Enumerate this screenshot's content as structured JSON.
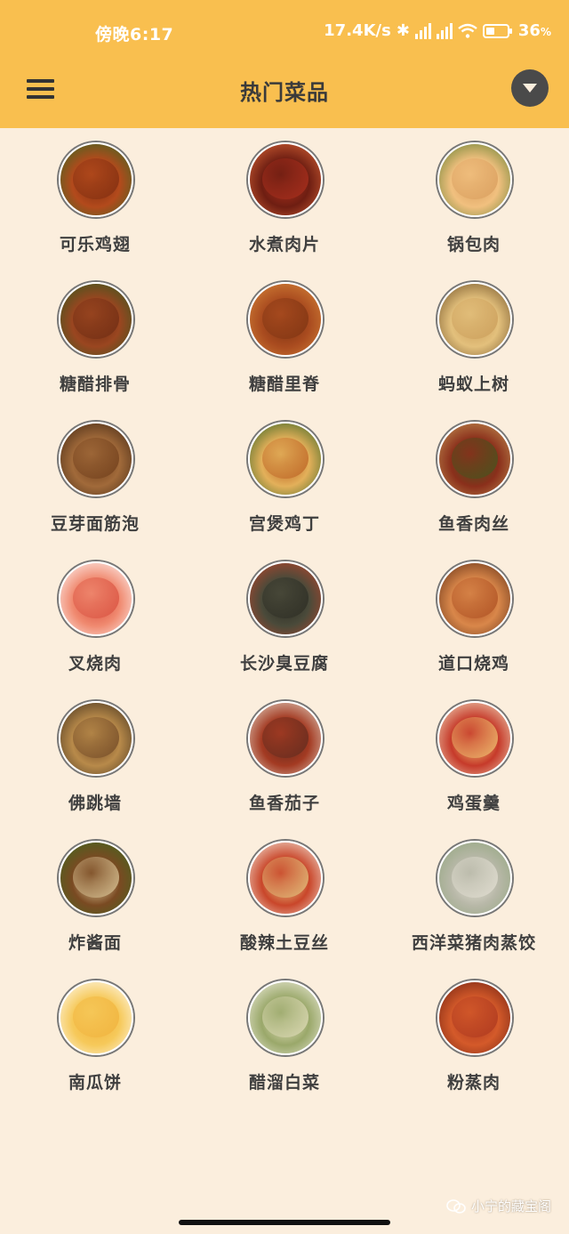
{
  "status_bar": {
    "time": "傍晚6:17",
    "net_speed": "17.4K/s",
    "battery": "36",
    "battery_unit": "%"
  },
  "toolbar": {
    "title": "热门菜品",
    "menu_icon": "hamburger-menu-icon",
    "dropdown_icon": "caret-down-icon"
  },
  "dishes": [
    {
      "name": "可乐鸡翅",
      "colors": [
        "#7a2b0f",
        "#b34a1c",
        "#2f6b22"
      ]
    },
    {
      "name": "水煮肉片",
      "colors": [
        "#b3321f",
        "#6e1e12",
        "#e06a3a"
      ]
    },
    {
      "name": "锅包肉",
      "colors": [
        "#d69a5a",
        "#f1c07f",
        "#5a7b2a"
      ]
    },
    {
      "name": "糖醋排骨",
      "colors": [
        "#6b2a12",
        "#9a4620",
        "#2c5a1e"
      ]
    },
    {
      "name": "糖醋里脊",
      "colors": [
        "#7a3211",
        "#a94b1f",
        "#d98a3b"
      ]
    },
    {
      "name": "蚂蚁上树",
      "colors": [
        "#c89a57",
        "#e3c07c",
        "#6a4b22"
      ]
    },
    {
      "name": "豆芽面筋泡",
      "colors": [
        "#6b3a18",
        "#a16a3a",
        "#3a2210"
      ]
    },
    {
      "name": "宫煲鸡丁",
      "colors": [
        "#b85a1e",
        "#e3b05a",
        "#2a5e1e"
      ]
    },
    {
      "name": "鱼香肉丝",
      "colors": [
        "#3c5a1e",
        "#8a2f1b",
        "#c79a57"
      ]
    },
    {
      "name": "叉烧肉",
      "colors": [
        "#d64a3a",
        "#f08a70",
        "#ffffff"
      ]
    },
    {
      "name": "长沙臭豆腐",
      "colors": [
        "#2a2a22",
        "#4a4a3a",
        "#c0452a"
      ]
    },
    {
      "name": "道口烧鸡",
      "colors": [
        "#a94a1e",
        "#d9874a",
        "#5a2a12"
      ]
    },
    {
      "name": "佛跳墙",
      "colors": [
        "#6a4222",
        "#b88a4a",
        "#3a2a1a"
      ]
    },
    {
      "name": "鱼香茄子",
      "colors": [
        "#5a2a1e",
        "#a33a22",
        "#e8e0d0"
      ]
    },
    {
      "name": "鸡蛋羹",
      "colors": [
        "#f5d47a",
        "#c63a2a",
        "#f4e8c8"
      ]
    },
    {
      "name": "炸酱面",
      "colors": [
        "#e8d7a8",
        "#7a4a22",
        "#3a6a1e"
      ]
    },
    {
      "name": "酸辣土豆丝",
      "colors": [
        "#e6d58a",
        "#c9462a",
        "#f7f2e4"
      ]
    },
    {
      "name": "西洋菜猪肉蒸饺",
      "colors": [
        "#e8e4d8",
        "#b8b8a8",
        "#8ea47a"
      ]
    },
    {
      "name": "南瓜饼",
      "colors": [
        "#f0b03a",
        "#f6c95a",
        "#ffffff"
      ]
    },
    {
      "name": "醋溜白菜",
      "colors": [
        "#e8e2c2",
        "#9aa86a",
        "#f6f2e6"
      ]
    },
    {
      "name": "粉蒸肉",
      "colors": [
        "#a8341e",
        "#d45a2a",
        "#6a1e10"
      ]
    }
  ],
  "watermark": {
    "text": "小宁的藏宝阁"
  }
}
